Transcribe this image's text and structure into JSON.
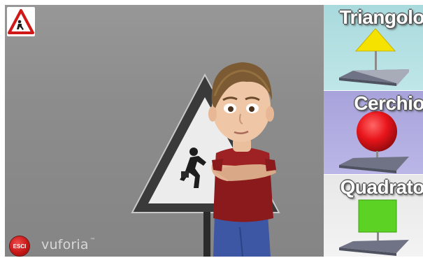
{
  "toolbar": {
    "warning_icon": "pedestrian-warning-sign-icon",
    "exit_label": "ESCI"
  },
  "branding": {
    "logo_text": "vuforia",
    "logo_mark": "™"
  },
  "shapes": [
    {
      "label": "Triangolo",
      "icon": "yellow-triangle-icon",
      "color": "#f5e200",
      "bg": "#b5e0e2"
    },
    {
      "label": "Cerchio",
      "icon": "red-circle-icon",
      "color": "#e8151b",
      "bg": "#b0acdf"
    },
    {
      "label": "Quadrato",
      "icon": "green-square-icon",
      "color": "#5cd224",
      "bg": "#eeeeee"
    }
  ]
}
